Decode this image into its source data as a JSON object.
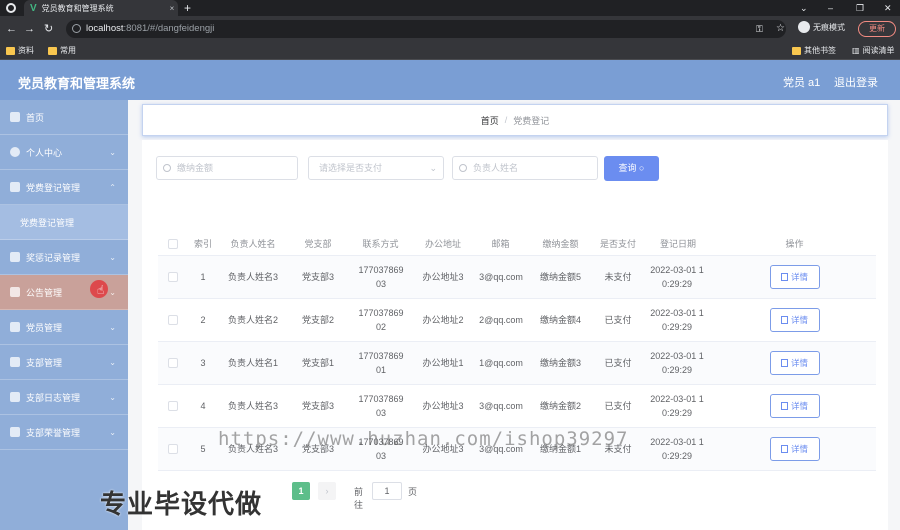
{
  "browser": {
    "tab_title": "党员教育和管理系统",
    "url_host": "localhost",
    "url_path": ":8081/#/dangfeidengji",
    "incognito_label": "无痕模式",
    "update_label": "更新",
    "bookmarks": [
      "资料",
      "常用"
    ],
    "bookmarks_right": [
      "其他书签",
      "阅读清单"
    ]
  },
  "header": {
    "title": "党员教育和管理系统",
    "user": "党员 a1",
    "logout": "退出登录"
  },
  "sidebar": {
    "items": [
      {
        "label": "首页",
        "icon": "home-icon"
      },
      {
        "label": "个人中心",
        "icon": "user-icon",
        "chevron": true
      },
      {
        "label": "党费登记管理",
        "icon": "gear-icon",
        "chevron": true
      },
      {
        "label": "党费登记管理",
        "sub": true
      },
      {
        "label": "奖惩记录管理",
        "icon": "award-icon",
        "chevron": true
      },
      {
        "label": "公告管理",
        "icon": "notice-icon",
        "chevron": true,
        "active": true
      },
      {
        "label": "党员管理",
        "icon": "people-icon",
        "chevron": true
      },
      {
        "label": "支部管理",
        "icon": "shield-icon",
        "chevron": true
      },
      {
        "label": "支部日志管理",
        "icon": "log-icon",
        "chevron": true
      },
      {
        "label": "支部荣誉管理",
        "icon": "chart-icon",
        "chevron": true
      }
    ]
  },
  "breadcrumb": {
    "home": "首页",
    "separator": "/",
    "current": "党费登记"
  },
  "search": {
    "amount_placeholder": "缴纳金额",
    "paid_placeholder": "请选择是否支付",
    "name_placeholder": "负责人姓名",
    "query_label": "查询"
  },
  "table": {
    "columns": [
      "索引",
      "负责人姓名",
      "党支部",
      "联系方式",
      "办公地址",
      "邮箱",
      "缴纳金额",
      "是否支付",
      "登记日期",
      "操作"
    ],
    "detail_label": "详情",
    "rows": [
      {
        "index": "1",
        "name": "负责人姓名3",
        "branch": "党支部3",
        "phone": "17703786903",
        "address": "办公地址3",
        "email": "3@qq.com",
        "amount": "缴纳金额5",
        "paid": "未支付",
        "date": "2022-03-01 10:29:29"
      },
      {
        "index": "2",
        "name": "负责人姓名2",
        "branch": "党支部2",
        "phone": "17703786902",
        "address": "办公地址2",
        "email": "2@qq.com",
        "amount": "缴纳金额4",
        "paid": "已支付",
        "date": "2022-03-01 10:29:29"
      },
      {
        "index": "3",
        "name": "负责人姓名1",
        "branch": "党支部1",
        "phone": "17703786901",
        "address": "办公地址1",
        "email": "1@qq.com",
        "amount": "缴纳金额3",
        "paid": "已支付",
        "date": "2022-03-01 10:29:29"
      },
      {
        "index": "4",
        "name": "负责人姓名3",
        "branch": "党支部3",
        "phone": "17703786903",
        "address": "办公地址3",
        "email": "3@qq.com",
        "amount": "缴纳金额2",
        "paid": "已支付",
        "date": "2022-03-01 10:29:29"
      },
      {
        "index": "5",
        "name": "负责人姓名3",
        "branch": "党支部3",
        "phone": "17703786903",
        "address": "办公地址3",
        "email": "3@qq.com",
        "amount": "缴纳金额1",
        "paid": "未支付",
        "date": "2022-03-01 10:29:29"
      }
    ]
  },
  "pagination": {
    "current_page": "1",
    "next": "›",
    "goto_label": "前往",
    "goto_value": "1",
    "unit": "页"
  },
  "watermarks": {
    "url": "https://www.huzhan.com/ishop39297",
    "text": "专业毕设代做"
  }
}
